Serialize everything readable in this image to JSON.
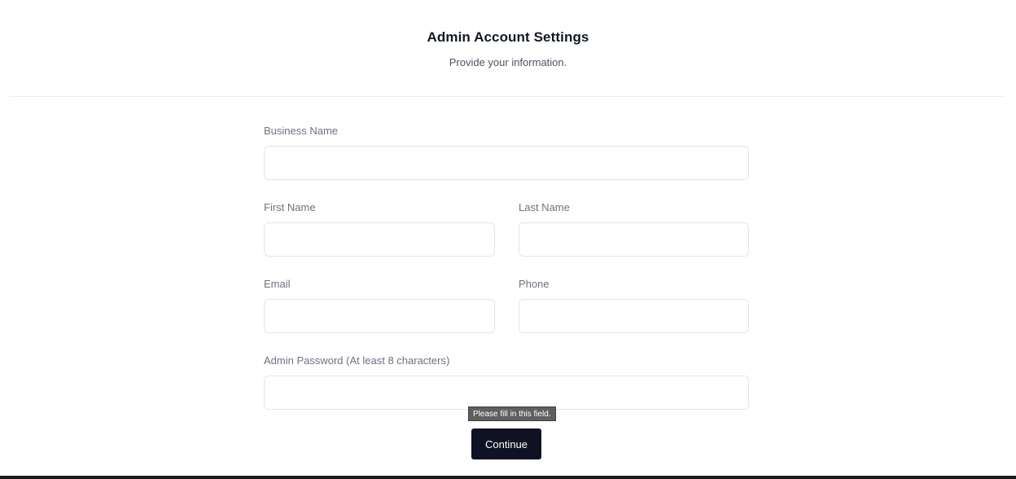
{
  "header": {
    "title": "Admin Account Settings",
    "subtitle": "Provide your information."
  },
  "form": {
    "business_name": {
      "label": "Business Name",
      "value": "",
      "placeholder": ""
    },
    "first_name": {
      "label": "First Name",
      "value": "",
      "placeholder": ""
    },
    "last_name": {
      "label": "Last Name",
      "value": "",
      "placeholder": ""
    },
    "email": {
      "label": "Email",
      "value": "",
      "placeholder": ""
    },
    "phone": {
      "label": "Phone",
      "value": "",
      "placeholder": ""
    },
    "admin_password": {
      "label": "Admin Password (At least 8 characters)",
      "value": "",
      "placeholder": ""
    },
    "validation_tooltip": "Please fill in this field.",
    "continue_label": "Continue"
  },
  "colors": {
    "primary_button": "#0f1222",
    "title_text": "#111827",
    "label_text": "#6b7280",
    "input_border": "#e2e5ea"
  }
}
